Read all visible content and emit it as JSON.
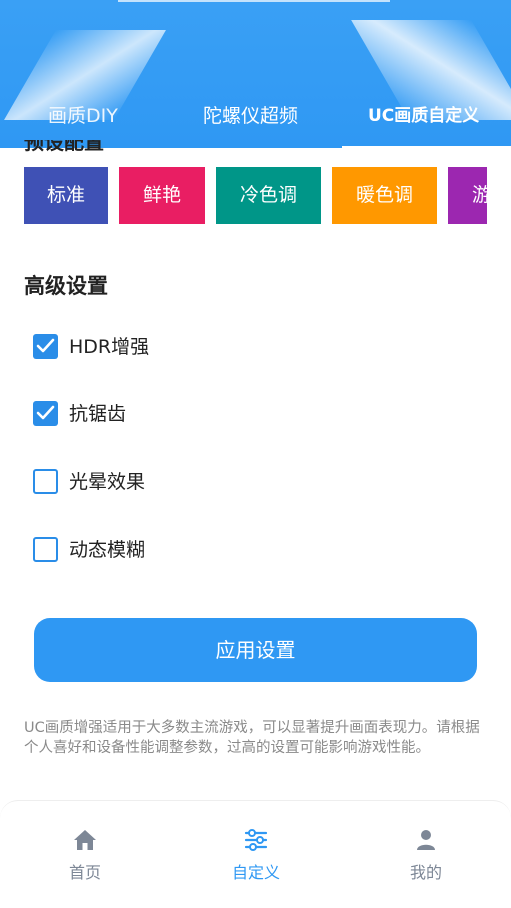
{
  "header": {
    "tabs": [
      {
        "label": "画质DIY"
      },
      {
        "label": "陀螺仪超频"
      },
      {
        "label": "UC画质自定义"
      }
    ],
    "colors": {
      "primary": "#2f98f3"
    }
  },
  "presets": {
    "section_title": "预设配置",
    "items": [
      {
        "label": "标准",
        "color": "#3f51b5"
      },
      {
        "label": "鲜艳",
        "color": "#e91e63"
      },
      {
        "label": "冷色调",
        "color": "#009688"
      },
      {
        "label": "暖色调",
        "color": "#ff9800"
      },
      {
        "label": "游",
        "color": "#9c27b0"
      }
    ]
  },
  "advanced": {
    "title": "高级设置",
    "options": [
      {
        "label": "HDR增强",
        "checked": true
      },
      {
        "label": "抗锯齿",
        "checked": true
      },
      {
        "label": "光晕效果",
        "checked": false
      },
      {
        "label": "动态模糊",
        "checked": false
      }
    ]
  },
  "apply_button": {
    "label": "应用设置"
  },
  "note": "UC画质增强适用于大多数主流游戏，可以显著提升画面表现力。请根据个人喜好和设备性能调整参数，过高的设置可能影响游戏性能。",
  "bottom_nav": {
    "items": [
      {
        "label": "首页",
        "icon": "home-icon",
        "active": false
      },
      {
        "label": "自定义",
        "icon": "sliders-icon",
        "active": true
      },
      {
        "label": "我的",
        "icon": "user-icon",
        "active": false
      }
    ]
  }
}
